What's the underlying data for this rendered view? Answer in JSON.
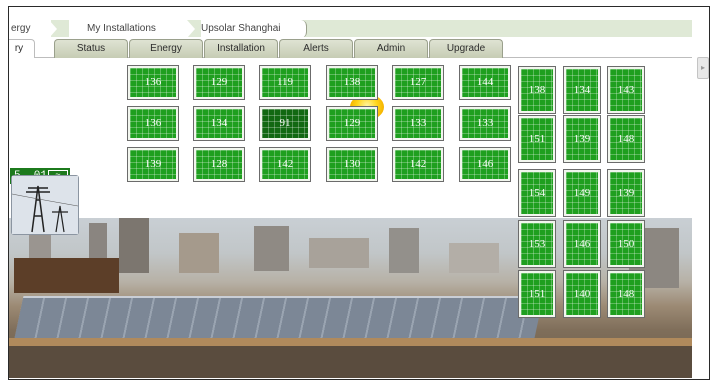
{
  "breadcrumb": {
    "items": [
      "ergy",
      "My Installations",
      "Upsolar Shanghai"
    ]
  },
  "tabs": [
    {
      "label": "ry",
      "active": true
    },
    {
      "label": "Status",
      "active": false
    },
    {
      "label": "Energy",
      "active": false
    },
    {
      "label": "Installation",
      "active": false
    },
    {
      "label": "Alerts",
      "active": false
    },
    {
      "label": "Admin",
      "active": false
    },
    {
      "label": "Upgrade",
      "active": false
    }
  ],
  "meter": {
    "value": "5. 01",
    "icon": "waveform-icon"
  },
  "scroll_button": {
    "icon": "chevron-right-icon",
    "glyph": "▸"
  },
  "colors": {
    "panel_green": "#1f9f1f",
    "panel_dim": "#126812",
    "tab_bg": "#c6ccb4",
    "header_band": "#dfe9d6"
  },
  "panel_grid_left": [
    [
      "136",
      "129",
      "119",
      "138",
      "127",
      "144"
    ],
    [
      "136",
      "134",
      "91",
      "129",
      "133",
      "133"
    ],
    [
      "139",
      "128",
      "142",
      "130",
      "142",
      "146"
    ]
  ],
  "panel_grid_right": [
    [
      "138",
      "134",
      "143"
    ],
    [
      "151",
      "139",
      "148"
    ],
    [
      "154",
      "149",
      "139"
    ],
    [
      "153",
      "146",
      "150"
    ],
    [
      "151",
      "140",
      "148"
    ]
  ]
}
